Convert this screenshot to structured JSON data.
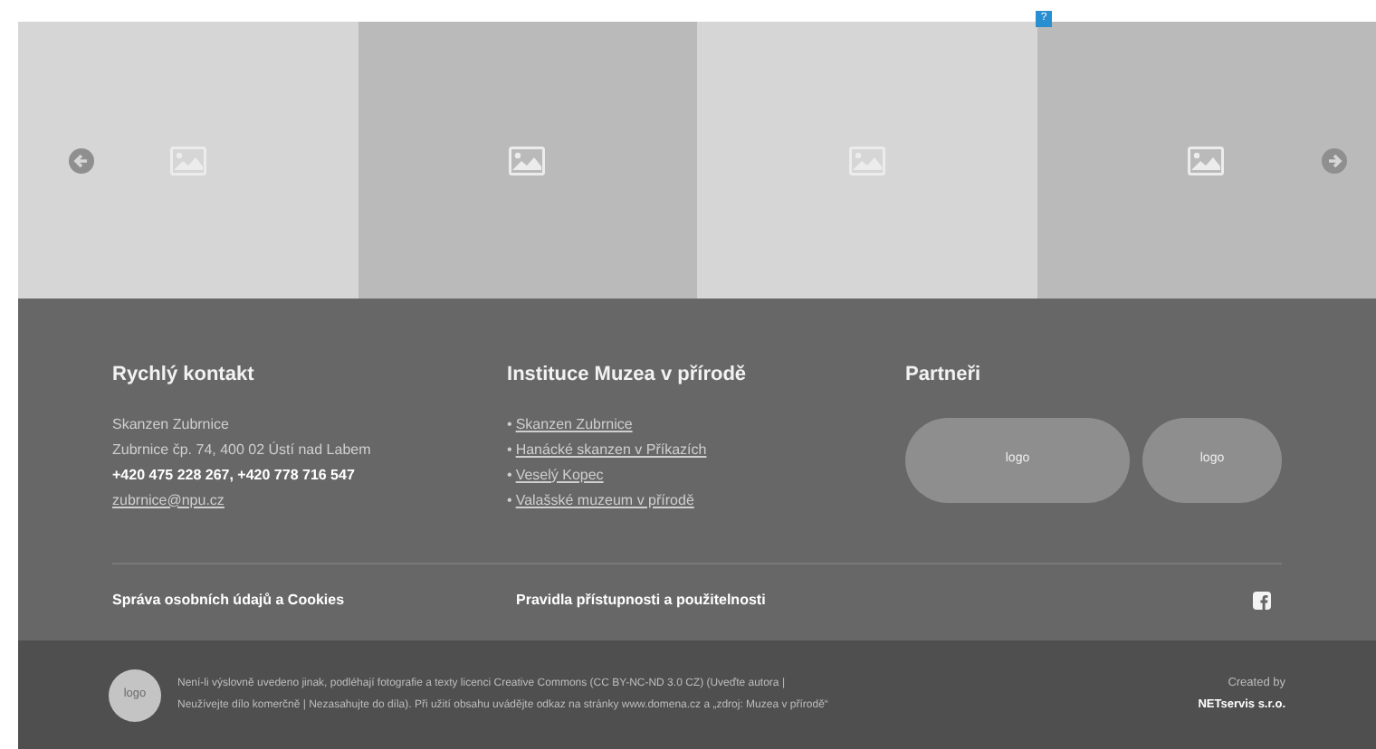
{
  "badge": "?",
  "carousel": {
    "slides": [
      {
        "kind": "light"
      },
      {
        "kind": "dark"
      },
      {
        "kind": "light"
      },
      {
        "kind": "dark"
      }
    ]
  },
  "contact": {
    "title": "Rychlý kontakt",
    "lines": [
      "Skanzen Zubrnice",
      "Zubrnice čp. 74, 400 02 Ústí nad Labem"
    ],
    "phones": "+420 475 228 267, +420 778 716 547",
    "email": "zubrnice@npu.cz"
  },
  "institutions": {
    "title": "Instituce Muzea v přírodě",
    "bullet": "•",
    "links": [
      "Skanzen Zubrnice",
      "Hanácké skanzen v Příkazích",
      "Veselý Kopec",
      "Valašské muzeum v přírodě"
    ]
  },
  "partners": {
    "title": "Partneři",
    "logos": [
      "logo",
      "logo"
    ]
  },
  "footer_links": [
    "Správa osobních údajů a Cookies",
    "Pravidla přístupnosti a použitelnosti"
  ],
  "bottom": {
    "logo": "logo",
    "license": [
      "Není-li výslovně uvedeno jinak, podléhají fotografie a texty licenci Creative Commons (CC BY-NC-ND 3.0 CZ) (Uveďte autora |",
      "Neužívejte dílo komerčně | Nezasahujte do díla). Při užití obsahu uvádějte odkaz na stránky www.domena.cz a „zdroj: Muzea v přírodě“"
    ],
    "created_by": "Created by",
    "company": "NETservis s.r.o."
  }
}
